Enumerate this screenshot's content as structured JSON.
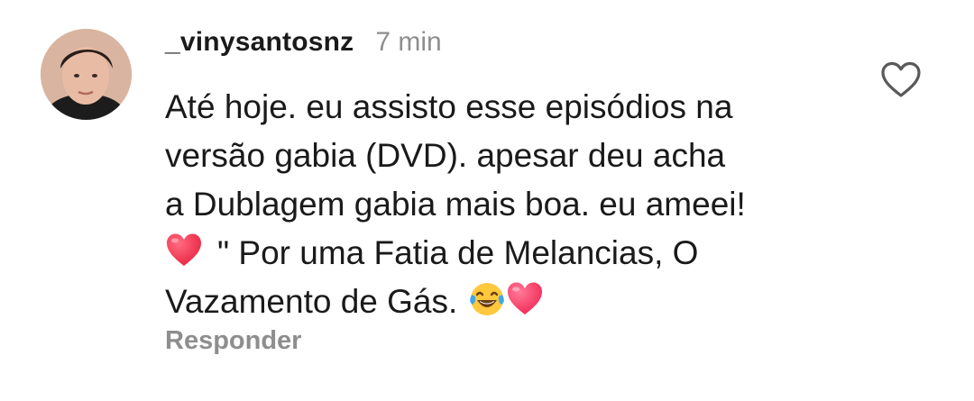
{
  "comment": {
    "avatar_icon": "user-avatar",
    "username": "_vinysantosnz",
    "timestamp": "7 min",
    "lines": {
      "l1": "Até hoje. eu assisto esse episódios na",
      "l2": "versão gabia (DVD). apesar deu acha",
      "l3": "a Dublagem gabia mais boa. eu ameei!",
      "l4": "\" Por uma Fatia de Melancias, O",
      "l5": "Vazamento de Gás."
    },
    "emojis": [
      "red-heart",
      "face-with-tears-of-joy",
      "pink-heart"
    ],
    "like_icon": "heart-outline-icon",
    "reply_label": "Responder"
  },
  "colors": {
    "text": "#1a1a1a",
    "muted": "#8e8e8e",
    "background": "#ffffff",
    "heart_red": "#f0304d",
    "heart_pink": "#ff2d64"
  }
}
